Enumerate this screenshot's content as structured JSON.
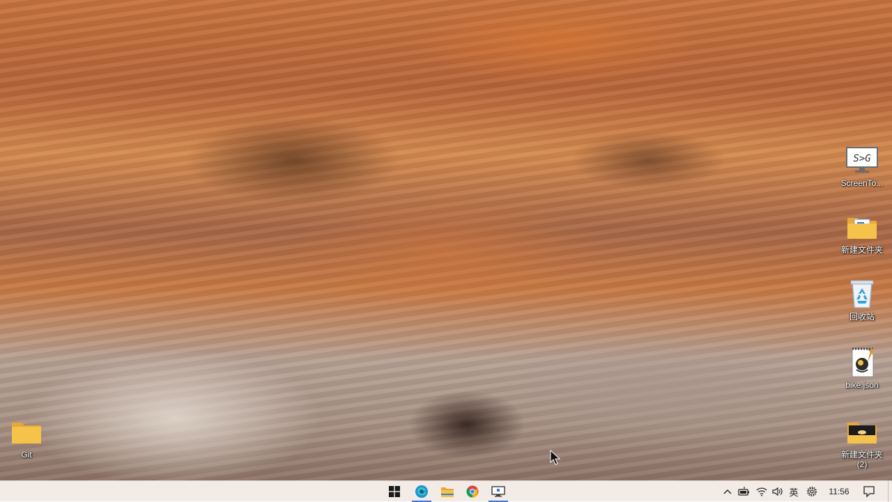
{
  "desktop": {
    "icons": [
      {
        "label": "ScreenTo...",
        "icon": "screentogif-icon"
      },
      {
        "label": "新建文件夹",
        "icon": "folder-with-document-icon"
      },
      {
        "label": "回收站",
        "icon": "recycle-bin-icon"
      },
      {
        "label": "bike.json",
        "icon": "json-file-icon"
      },
      {
        "label": "Git",
        "icon": "folder-icon"
      },
      {
        "label": "新建文件夹\n(2)",
        "icon": "folder-with-image-icon"
      }
    ],
    "screentogif_glyph_text": "S>G"
  },
  "taskbar": {
    "apps": [
      {
        "name": "start-button",
        "icon": "windows-logo-icon"
      },
      {
        "name": "edge",
        "icon": "edge-icon",
        "active": true
      },
      {
        "name": "file-explorer",
        "icon": "file-explorer-icon"
      },
      {
        "name": "chrome",
        "icon": "chrome-icon"
      },
      {
        "name": "remote-desktop",
        "icon": "monitor-icon",
        "active": true
      }
    ],
    "tray": {
      "ime_label": "英",
      "clock": "11:56"
    }
  },
  "colors": {
    "taskbar_bg": "#f2ebe6",
    "active_indicator": "#3a7bd5",
    "folder_yellow": "#f5c24a"
  }
}
